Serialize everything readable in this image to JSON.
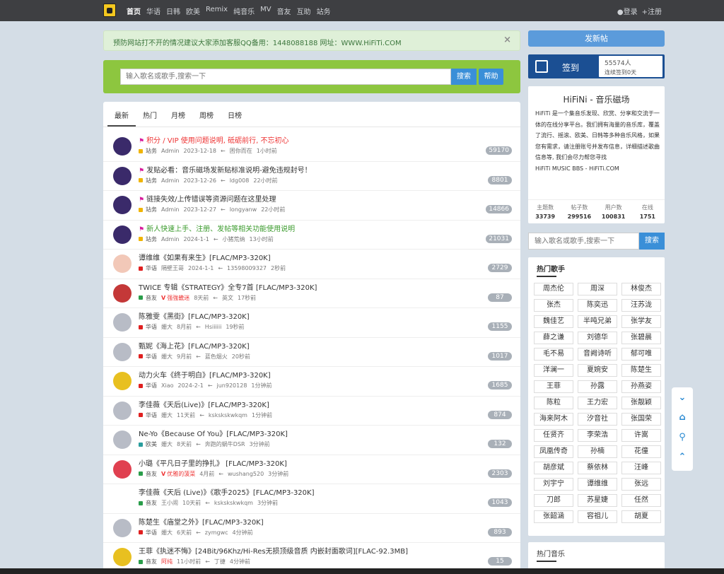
{
  "nav": {
    "links": [
      "首页",
      "华语",
      "日韩",
      "欧美",
      "Remix",
      "纯音乐",
      "MV",
      "音友",
      "互助",
      "站务"
    ],
    "login": "登录",
    "register": "注册"
  },
  "alert": {
    "text": "预防网站打不开的情况建议大家添加客服QQ备用：1448088188 网址：WWW.HiFiTi.COM",
    "close": "×"
  },
  "search": {
    "placeholder": "输入歌名或歌手,搜索一下",
    "button": "搜索",
    "help": "帮助"
  },
  "tabs": [
    "最新",
    "热门",
    "月榜",
    "周榜",
    "日榜"
  ],
  "threads": [
    {
      "title": "积分 / VIP 使用问题说明, 砥砺前行, 不忘初心",
      "style": "red",
      "flag": true,
      "dot": "#f0b400",
      "cat": "站务",
      "user": "Admin",
      "date": "2023-12-18",
      "arrow": "←",
      "last": "困你而在",
      "time": "1小时前",
      "count": "59170",
      "avatar": "#3a2a6a"
    },
    {
      "title": "发贴必看：音乐磁场发新贴标准说明-避免违规封号！",
      "style": "",
      "flag": true,
      "dot": "#f0b400",
      "cat": "站务",
      "user": "Admin",
      "date": "2023-12-26",
      "arrow": "←",
      "last": "ldg008",
      "time": "22小时前",
      "count": "8801",
      "avatar": "#3a2a6a"
    },
    {
      "title": "链接失效/上传错误等资源问题在这里处理",
      "style": "",
      "flag": true,
      "dot": "#f0b400",
      "cat": "站务",
      "user": "Admin",
      "date": "2023-12-27",
      "arrow": "←",
      "last": "longyanw",
      "time": "22小时前",
      "count": "14866",
      "avatar": "#3a2a6a"
    },
    {
      "title": "新人快速上手、注册、发帖等相关功能使用说明",
      "style": "green",
      "flag": true,
      "dot": "#f0b400",
      "cat": "站务",
      "user": "Admin",
      "date": "2024-1-1",
      "arrow": "←",
      "last": "小猪荒纳",
      "time": "13小时前",
      "count": "21031",
      "avatar": "#3a2a6a"
    },
    {
      "title": "谭维维《如果有来生》[FLAC/MP3-320K]",
      "style": "",
      "flag": false,
      "dot": "#e02020",
      "cat": "华语",
      "user": "隔壁王哥",
      "date": "2024-1-1",
      "arrow": "←",
      "last": "13598009327",
      "time": "2秒前",
      "count": "2729",
      "avatar": "#f2c8b8"
    },
    {
      "title": "TWICE 专辑《STRATEGY》全专7首 [FLAC/MP3-320K]",
      "style": "",
      "flag": false,
      "dot": "#2a9d4a",
      "cat": "音友",
      "user": "强強畿迷",
      "date": "8天前",
      "arrow": "←",
      "last": "英文",
      "time": "17秒前",
      "count": "87",
      "avatar": "#c43838",
      "vip": true
    },
    {
      "title": "陈雅雯《黑街》[FLAC/MP3-320K]",
      "style": "",
      "flag": false,
      "dot": "#e02020",
      "cat": "华语",
      "user": "姗大",
      "date": "8月前",
      "arrow": "←",
      "last": "Hsiiiiii",
      "time": "19秒前",
      "count": "1155",
      "avatar": "#b8bcc6"
    },
    {
      "title": "甄妮《海上花》[FLAC/MP3-320K]",
      "style": "",
      "flag": false,
      "dot": "#e02020",
      "cat": "华语",
      "user": "姗大",
      "date": "9月前",
      "arrow": "←",
      "last": "蓝色烟火",
      "time": "20秒前",
      "count": "1017",
      "avatar": "#b8bcc6"
    },
    {
      "title": "动力火车《终于明白》[FLAC/MP3-320K]",
      "style": "",
      "flag": false,
      "dot": "#e02020",
      "cat": "华语",
      "user": "Xiao",
      "date": "2024-2-1",
      "arrow": "←",
      "last": "jun920128",
      "time": "1分钟前",
      "count": "1685",
      "avatar": "#e8c020"
    },
    {
      "title": "李佳薇《天后(Live)》[FLAC/MP3-320K]",
      "style": "",
      "flag": false,
      "dot": "#e02020",
      "cat": "华语",
      "user": "姗大",
      "date": "11天前",
      "arrow": "←",
      "last": "kskskskwkqm",
      "time": "1分钟前",
      "count": "874",
      "avatar": "#b8bcc6"
    },
    {
      "title": "Ne-Yo《Because Of You》[FLAC/MP3-320K]",
      "style": "",
      "flag": false,
      "dot": "#2a9d9d",
      "cat": "欧美",
      "user": "姗大",
      "date": "8天前",
      "arrow": "←",
      "last": "奔跑的蜗牛DSR",
      "time": "3分钟前",
      "count": "132",
      "avatar": "#b8bcc6"
    },
    {
      "title": "小璐《平凡日子里的挣扎》 [FLAC/MP3-320K]",
      "style": "",
      "flag": false,
      "dot": "#2a9d4a",
      "cat": "音友",
      "user": "优雅的菠菜",
      "date": "4月前",
      "arrow": "←",
      "last": "wushang520",
      "time": "3分钟前",
      "count": "2303",
      "avatar": "#e04050",
      "vip": true
    },
    {
      "title": "李佳薇《天后 (Live)》《歌手2025》[FLAC/MP3-320K]",
      "style": "",
      "flag": false,
      "dot": "#2a9d4a",
      "cat": "音友",
      "user": "王小闹",
      "date": "10天前",
      "arrow": "←",
      "last": "kskskskwkqm",
      "time": "3分钟前",
      "count": "1043",
      "avatar": "#ffffff"
    },
    {
      "title": "陈楚生《庙堂之外》[FLAC/MP3-320K]",
      "style": "",
      "flag": false,
      "dot": "#e02020",
      "cat": "华语",
      "user": "姗大",
      "date": "6天前",
      "arrow": "←",
      "last": "zymgwc",
      "time": "4分钟前",
      "count": "893",
      "avatar": "#b8bcc6"
    },
    {
      "title": "王菲《执迷不悔》[24Bit/96Khz/Hi-Res无损顶级音质 内嵌封面歌词][FLAC-92.3MB]",
      "style": "",
      "flag": false,
      "dot": "#2a9d4a",
      "cat": "音友",
      "user": "阿纯",
      "date": "11小时前",
      "arrow": "←",
      "last": "丁捷",
      "time": "4分钟前",
      "count": "15",
      "avatar": "#e8c020",
      "redUser": true
    }
  ],
  "sidebar": {
    "post_button": "发新帖",
    "sign_label": "签到",
    "sign_count": "55574人",
    "sign_streak": "连续签到0天",
    "about_title": "HiFiNi - 音乐磁场",
    "about_text": "HiFiTi 是一个集音乐发现、欣赏、分享和交流于一体的在线分享平台。我们拥有海量的音乐库，覆盖了流行、摇滚、欧美、日韩等多种音乐风格，如果您有需求，请注册账号并发布信息，详细描述歌曲信息等, 我们会尽力帮您寻找",
    "about_footer": "HiFiTi MUSIC BBS - HiFiTi.COM",
    "stats": [
      {
        "k": "主题数",
        "v": "33739"
      },
      {
        "k": "帖子数",
        "v": "299516"
      },
      {
        "k": "用户数",
        "v": "100831"
      },
      {
        "k": "在线",
        "v": "1751"
      }
    ],
    "search_placeholder": "输入歌名或歌手,搜索一下",
    "search_button": "搜索",
    "singers_title": "热门歌手",
    "singers": [
      "周杰伦",
      "周深",
      "林俊杰",
      "张杰",
      "陈奕迅",
      "汪苏泷",
      "魏佳艺",
      "半吨兄弟",
      "张学友",
      "薛之谦",
      "刘德华",
      "张碧晨",
      "毛不易",
      "音阙诗听",
      "郁可唯",
      "洋澜一",
      "夏婉安",
      "陈楚生",
      "王菲",
      "孙露",
      "孙燕姿",
      "陈粒",
      "王力宏",
      "张靓颖",
      "海来阿木",
      "汐音社",
      "张国荣",
      "任贤齐",
      "李荣浩",
      "许嵩",
      "凤凰传奇",
      "孙楠",
      "花僮",
      "胡彦斌",
      "蔡依林",
      "汪峰",
      "刘宇宁",
      "谭维维",
      "张远",
      "刀郎",
      "苏星婕",
      "任然",
      "张韶涵",
      "容祖儿",
      "胡夏"
    ],
    "music_title": "热门音乐"
  },
  "float": [
    "chevron-down",
    "home",
    "search",
    "chevron-up"
  ]
}
